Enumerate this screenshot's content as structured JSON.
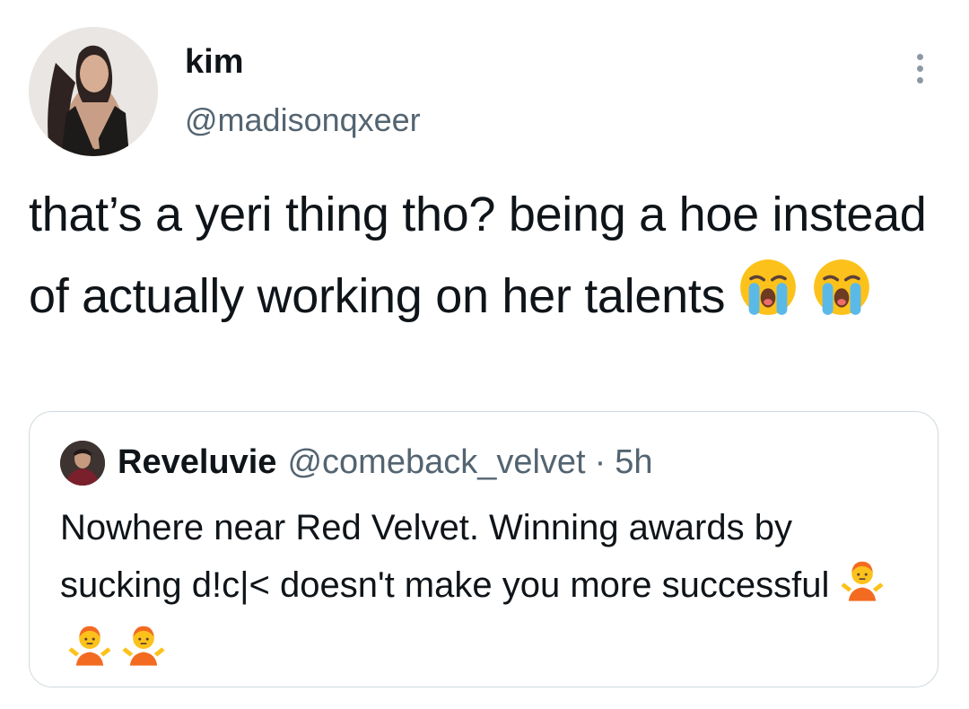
{
  "tweet": {
    "author": {
      "name": "kim",
      "handle": "@madisonqxeer"
    },
    "menu_icon": "more-vertical-icon",
    "text": "that’s a yeri thing tho? being a hoe instead of actually working on her talents",
    "emojis": [
      "loudly-crying-face",
      "loudly-crying-face"
    ]
  },
  "quoted_tweet": {
    "name": "Reveluvie",
    "handle": "@comeback_velvet",
    "separator": "·",
    "time": "5h",
    "text": "Nowhere near Red Velvet. Winning awards by sucking d!c|< doesn't make you more successful",
    "emojis": [
      "person-shrugging",
      "person-shrugging",
      "person-shrugging"
    ]
  },
  "colors": {
    "text_primary": "#0f1419",
    "text_secondary": "#536471",
    "border": "#cfd9de"
  }
}
